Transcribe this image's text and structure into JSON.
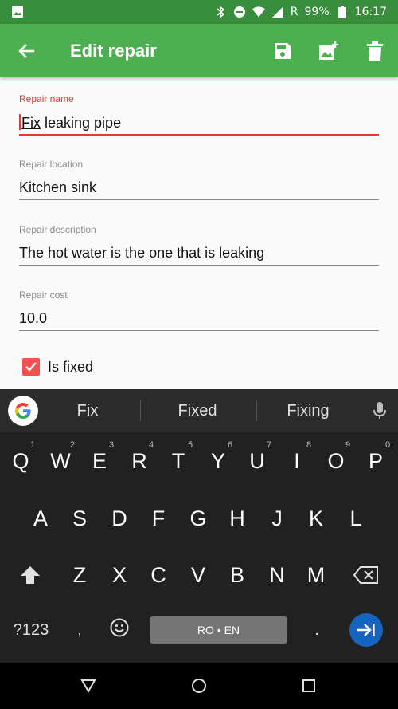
{
  "status_bar": {
    "battery": "99%",
    "time": "16:17",
    "roaming": "R",
    "icons": [
      "image-icon",
      "bluetooth-icon",
      "do-not-disturb-icon",
      "wifi-icon",
      "signal-icon",
      "battery-icon"
    ]
  },
  "app_bar": {
    "title": "Edit repair",
    "color": "#4caf50",
    "actions": [
      "save-icon",
      "add-photo-icon",
      "delete-icon"
    ]
  },
  "form": {
    "name": {
      "label": "Repair name",
      "value_prefix": "Fix",
      "value_rest": " leaking pipe"
    },
    "location": {
      "label": "Repair location",
      "value": "Kitchen sink"
    },
    "description": {
      "label": "Repair description",
      "value": "The hot water is the one that is leaking"
    },
    "cost": {
      "label": "Repair cost",
      "value": "10.0"
    },
    "fixed": {
      "label": "Is fixed",
      "checked": true
    }
  },
  "keyboard": {
    "suggestions": [
      "Fix",
      "Fixed",
      "Fixing"
    ],
    "row1": [
      "Q",
      "W",
      "E",
      "R",
      "T",
      "Y",
      "U",
      "I",
      "O",
      "P"
    ],
    "row1_hints": [
      "1",
      "2",
      "3",
      "4",
      "5",
      "6",
      "7",
      "8",
      "9",
      "0"
    ],
    "row2": [
      "A",
      "S",
      "D",
      "F",
      "G",
      "H",
      "J",
      "K",
      "L"
    ],
    "row3": [
      "Z",
      "X",
      "C",
      "V",
      "B",
      "N",
      "M"
    ],
    "symbols_key": "?123",
    "comma_key": ",",
    "period_key": ".",
    "space_label": "RO • EN",
    "accent_color": "#1565c0"
  }
}
